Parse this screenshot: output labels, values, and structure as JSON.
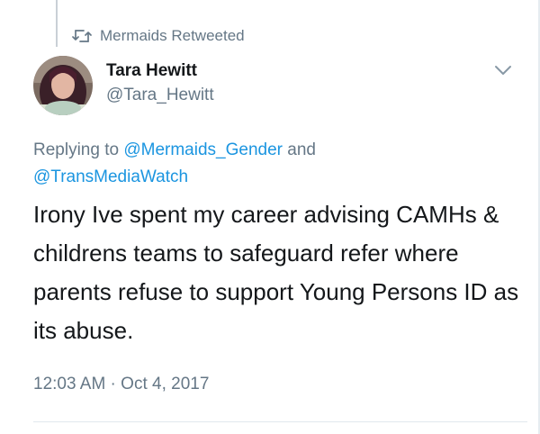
{
  "retweet": {
    "icon": "retweet-icon",
    "label": "Mermaids Retweeted"
  },
  "author": {
    "display_name": "Tara Hewitt",
    "handle": "@Tara_Hewitt",
    "avatar_icon": "avatar"
  },
  "menu": {
    "icon": "chevron-down-icon"
  },
  "reply": {
    "prefix": "Replying to ",
    "mention1": "@Mermaids_Gender",
    "joiner": " and",
    "mention2": "@TransMediaWatch"
  },
  "tweet": {
    "text": "Irony Ive spent my career advising CAMHs & childrens teams to safeguard refer where parents refuse to support Young Persons ID as its abuse.",
    "timestamp": "12:03 AM · Oct 4, 2017"
  },
  "colors": {
    "mention": "#1b95e0",
    "secondary_text": "#657786",
    "primary_text": "#14171a"
  }
}
